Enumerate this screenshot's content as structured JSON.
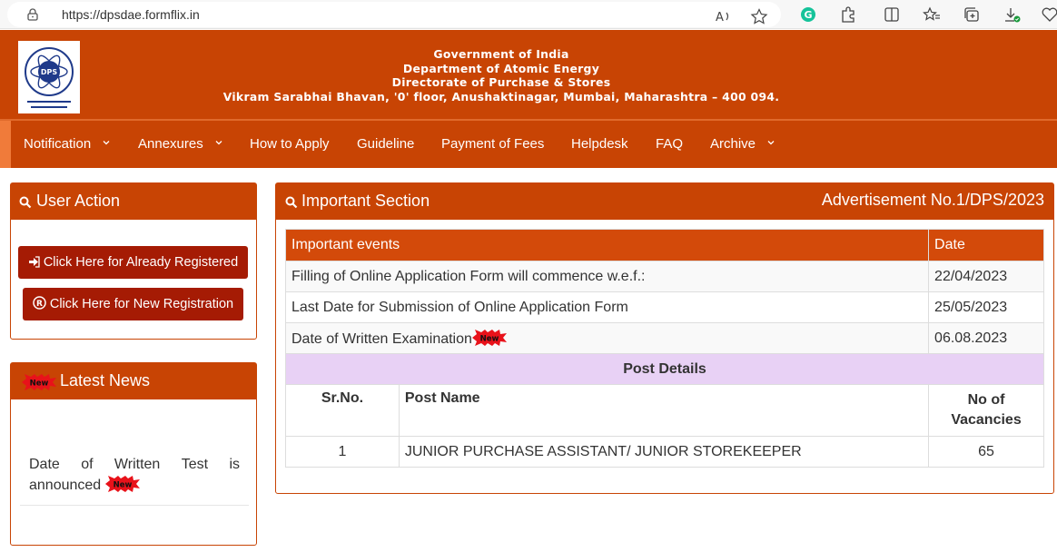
{
  "browser": {
    "url": "https://dpsdae.formflix.in"
  },
  "header": {
    "line1": "Government of India",
    "line2": "Department of Atomic Energy",
    "line3": "Directorate of Purchase & Stores",
    "line4": "Vikram Sarabhai Bhavan, '0' floor, Anushaktinagar, Mumbai, Maharashtra – 400 094.",
    "logo_text": "DPS"
  },
  "nav": {
    "items": [
      {
        "label": "Notification",
        "dropdown": true
      },
      {
        "label": "Annexures",
        "dropdown": true
      },
      {
        "label": "How to Apply",
        "dropdown": false
      },
      {
        "label": "Guideline",
        "dropdown": false
      },
      {
        "label": "Payment of Fees",
        "dropdown": false
      },
      {
        "label": "Helpdesk",
        "dropdown": false
      },
      {
        "label": "FAQ",
        "dropdown": false
      },
      {
        "label": "Archive",
        "dropdown": true
      }
    ]
  },
  "user_action": {
    "title": "User Action",
    "btn_registered": "Click Here for Already Registered",
    "btn_new": "Click Here for New Registration"
  },
  "latest_news": {
    "title": "Latest News",
    "item_words": [
      "Date",
      "of",
      "Written",
      "Test",
      "is"
    ],
    "item_line2": "announced"
  },
  "badge": {
    "label": "New"
  },
  "important": {
    "title": "Important Section",
    "advertisement": "Advertisement No.1/DPS/2023",
    "head_event": "Important events",
    "head_date": "Date",
    "events": [
      {
        "label": "Filling of Online Application Form will commence w.e.f.:",
        "date": "22/04/2023"
      },
      {
        "label": "Last Date for Submission of Online Application Form",
        "date": "25/05/2023"
      },
      {
        "label": "Date of Written Examination",
        "date": "06.08.2023"
      }
    ],
    "post_details": "Post Details",
    "col_srno": "Sr.No.",
    "col_post": "Post Name",
    "col_vacancies_1": "No of",
    "col_vacancies_2": "Vacancies",
    "posts": [
      {
        "srno": "1",
        "name": "JUNIOR PURCHASE ASSISTANT/ JUNIOR STOREKEEPER",
        "vacancies": "65"
      }
    ]
  },
  "colors": {
    "brand": "#c84404",
    "button": "#a51b04",
    "table_head": "#d34a0a",
    "post_head": "#e8d1f5"
  }
}
